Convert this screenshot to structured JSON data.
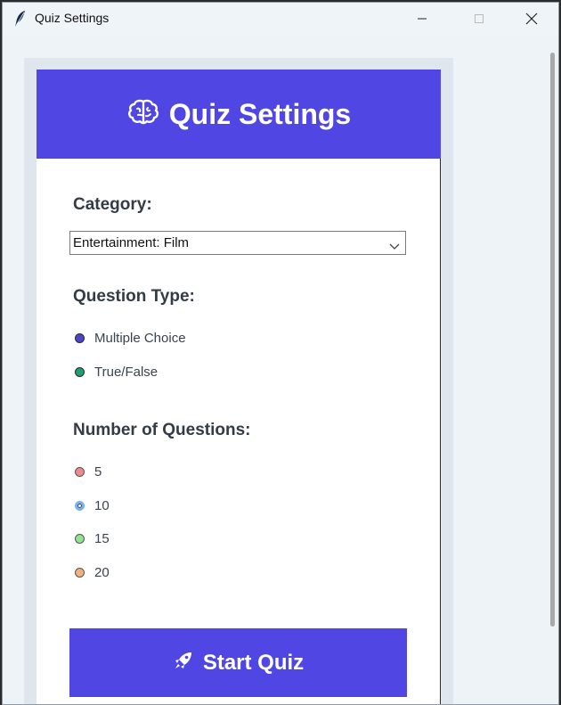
{
  "window": {
    "title": "Quiz Settings"
  },
  "header": {
    "title": "Quiz Settings",
    "icon": "brain-icon"
  },
  "category": {
    "label": "Category:",
    "selected": "Entertainment: Film"
  },
  "question_type": {
    "label": "Question Type:",
    "options": [
      {
        "label": "Multiple Choice",
        "color": "#4a46c9",
        "checked": true
      },
      {
        "label": "True/False",
        "color": "#1e9e74",
        "checked": true
      }
    ]
  },
  "num_questions": {
    "label": "Number of Questions:",
    "options": [
      {
        "label": "5",
        "color": "#f08a8a",
        "checked": false
      },
      {
        "label": "10",
        "color": "#7fb0e8",
        "checked": true
      },
      {
        "label": "15",
        "color": "#8ee68e",
        "checked": false
      },
      {
        "label": "20",
        "color": "#f5b07a",
        "checked": false
      }
    ]
  },
  "start_button": {
    "label": "Start Quiz",
    "icon": "rocket-icon"
  },
  "colors": {
    "accent": "#5046e4",
    "panel_bg": "#ffffff",
    "label_text": "#333b47"
  }
}
